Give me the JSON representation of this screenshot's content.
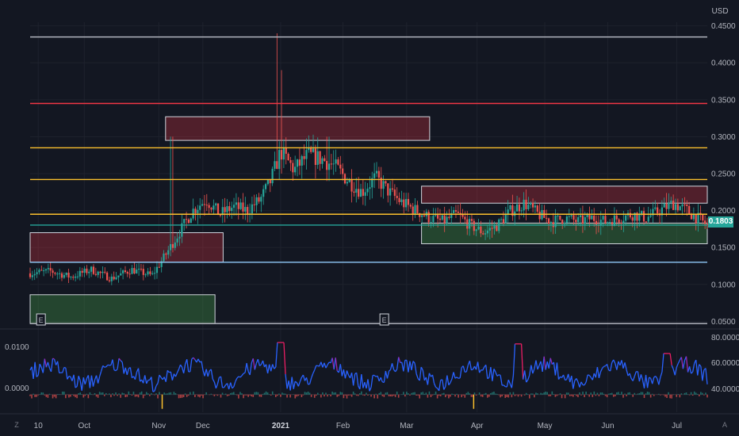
{
  "chart_data": [
    {
      "type": "candlestick",
      "currency_label": "USD",
      "ylim": [
        0.045,
        0.455
      ],
      "y_ticks": [
        "0.4500",
        "0.4000",
        "0.3500",
        "0.3000",
        "0.2500",
        "0.2000",
        "0.1500",
        "0.1000",
        "0.0500"
      ],
      "x_ticks": [
        "10",
        "Oct",
        "Nov",
        "Dec",
        "2021",
        "Feb",
        "Mar",
        "Apr",
        "May",
        "Jun",
        "Jul"
      ],
      "x_tick_bold": "2021",
      "last_price": "0.1803",
      "price_path": [
        [
          0.0,
          0.115
        ],
        [
          0.03,
          0.118
        ],
        [
          0.06,
          0.11
        ],
        [
          0.09,
          0.12
        ],
        [
          0.12,
          0.108
        ],
        [
          0.15,
          0.12
        ],
        [
          0.18,
          0.112
        ],
        [
          0.2,
          0.14
        ],
        [
          0.22,
          0.17
        ],
        [
          0.24,
          0.2
        ],
        [
          0.26,
          0.215
        ],
        [
          0.28,
          0.195
        ],
        [
          0.3,
          0.205
        ],
        [
          0.32,
          0.2
        ],
        [
          0.34,
          0.215
        ],
        [
          0.355,
          0.24
        ],
        [
          0.37,
          0.28
        ],
        [
          0.39,
          0.255
        ],
        [
          0.41,
          0.275
        ],
        [
          0.43,
          0.27
        ],
        [
          0.45,
          0.26
        ],
        [
          0.47,
          0.24
        ],
        [
          0.49,
          0.225
        ],
        [
          0.51,
          0.245
        ],
        [
          0.53,
          0.225
        ],
        [
          0.55,
          0.21
        ],
        [
          0.57,
          0.2
        ],
        [
          0.59,
          0.19
        ],
        [
          0.61,
          0.185
        ],
        [
          0.63,
          0.195
        ],
        [
          0.65,
          0.18
        ],
        [
          0.67,
          0.17
        ],
        [
          0.69,
          0.18
        ],
        [
          0.71,
          0.2
        ],
        [
          0.73,
          0.21
        ],
        [
          0.75,
          0.195
        ],
        [
          0.77,
          0.185
        ],
        [
          0.79,
          0.19
        ],
        [
          0.81,
          0.185
        ],
        [
          0.83,
          0.19
        ],
        [
          0.85,
          0.185
        ],
        [
          0.87,
          0.19
        ],
        [
          0.89,
          0.195
        ],
        [
          0.91,
          0.19
        ],
        [
          0.93,
          0.2
        ],
        [
          0.95,
          0.21
        ],
        [
          0.97,
          0.2
        ],
        [
          1.0,
          0.18
        ]
      ],
      "spikes": [
        [
          0.364,
          0.44,
          0.27
        ],
        [
          0.37,
          0.39,
          0.25
        ],
        [
          0.209,
          0.3,
          0.16
        ],
        [
          0.44,
          0.3,
          0.24
        ]
      ],
      "horizontal_levels": [
        {
          "price": 0.435,
          "color": "#b2b5be"
        },
        {
          "price": 0.345,
          "color": "#f23645"
        },
        {
          "price": 0.285,
          "color": "#fbc02d"
        },
        {
          "price": 0.242,
          "color": "#fbc02d"
        },
        {
          "price": 0.195,
          "color": "#fbc02d"
        },
        {
          "price": 0.1803,
          "color": "#26a69a"
        },
        {
          "price": 0.13,
          "color": "#90caf9"
        },
        {
          "price": 0.047,
          "color": "#b2b5be"
        }
      ],
      "zones": [
        {
          "type": "supply",
          "x_from": 0.2,
          "x_to": 0.59,
          "y_from": 0.295,
          "y_to": 0.327
        },
        {
          "type": "supply",
          "x_from": 0.0,
          "x_to": 0.285,
          "y_from": 0.13,
          "y_to": 0.17
        },
        {
          "type": "supply",
          "x_from": 0.578,
          "x_to": 1.0,
          "y_from": 0.21,
          "y_to": 0.233
        },
        {
          "type": "demand",
          "x_from": 0.578,
          "x_to": 1.0,
          "y_from": 0.155,
          "y_to": 0.183
        },
        {
          "type": "demand",
          "x_from": 0.0,
          "x_to": 0.273,
          "y_from": 0.047,
          "y_to": 0.086
        }
      ],
      "event_markers": [
        {
          "label": "E",
          "x": 0.016
        },
        {
          "label": "E",
          "x": 0.523
        }
      ]
    },
    {
      "type": "oscillator",
      "left_axis": [
        "0.0100",
        "0.0000"
      ],
      "right_axis": [
        "80.0000",
        "60.0000",
        "40.0000"
      ],
      "right_ylim": [
        30,
        85
      ]
    }
  ],
  "corner_buttons": {
    "zoom": "Z",
    "auto": "A"
  },
  "colors": {
    "background": "#131722",
    "grid": "#1e222d",
    "up": "#26a69a",
    "down": "#ef5350",
    "rsi": "#2962ff"
  }
}
